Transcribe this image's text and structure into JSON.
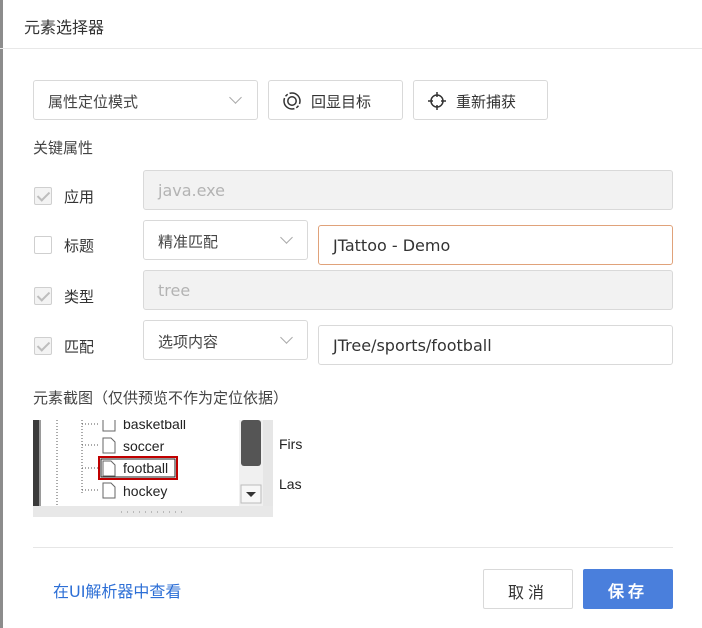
{
  "dialog": {
    "title": "元素选择器"
  },
  "toolbar": {
    "mode_select": "属性定位模式",
    "echo_button": "回显目标",
    "recapture_button": "重新捕获"
  },
  "key_attributes": {
    "heading": "关键属性",
    "rows": [
      {
        "label": "应用",
        "checked": true,
        "value": "java.exe",
        "disabled": true
      },
      {
        "label": "标题",
        "checked": false,
        "match_mode": "精准匹配",
        "value": "JTattoo - Demo",
        "disabled": false
      },
      {
        "label": "类型",
        "checked": true,
        "value": "tree",
        "disabled": true
      },
      {
        "label": "匹配",
        "checked": true,
        "match_mode": "选项内容",
        "value": "JTree/sports/football",
        "disabled": false
      }
    ]
  },
  "screenshot": {
    "heading": "元素截图（仅供预览不作为定位依据）",
    "tree_items": [
      "basketball",
      "soccer",
      "football",
      "hockey"
    ],
    "selected_item": "football",
    "side_labels": [
      "Firs",
      "Las"
    ]
  },
  "footer": {
    "inspect_link": "在UI解析器中查看",
    "cancel_button": "取消",
    "save_button": "保存"
  },
  "colors": {
    "primary": "#4a7fdc",
    "link": "#2d6fd6",
    "focus_border": "#e0a27a",
    "highlight_box": "#c00000"
  }
}
